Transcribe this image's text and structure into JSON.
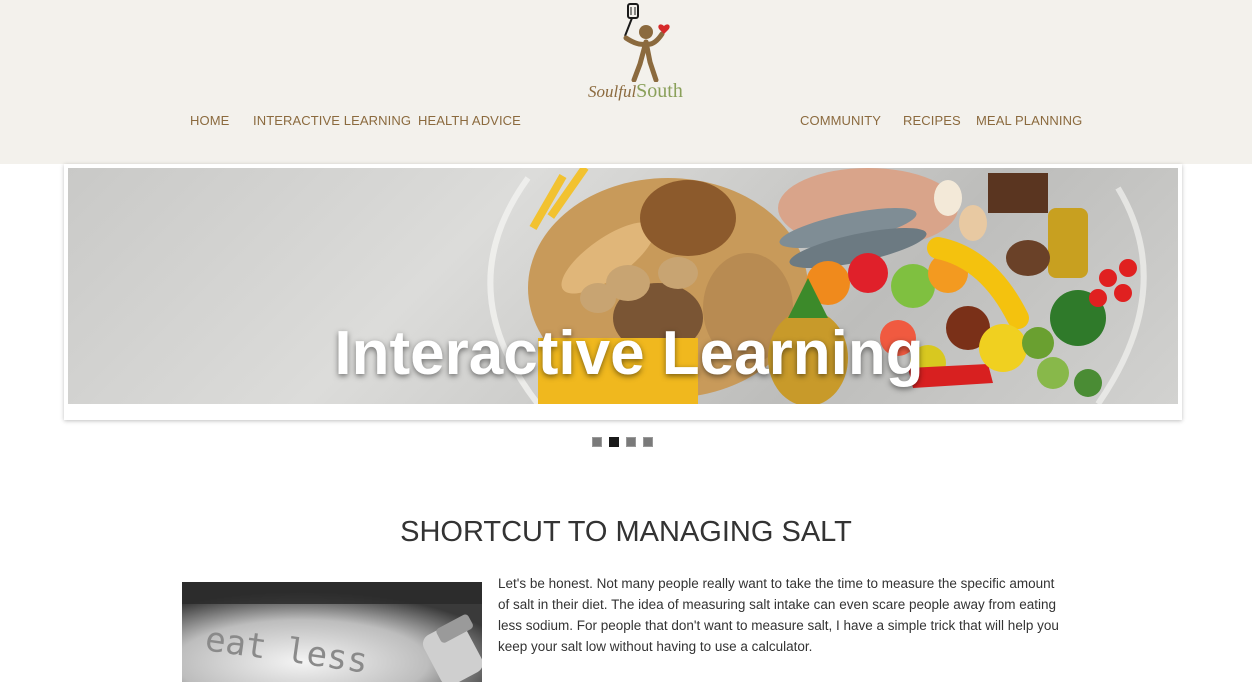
{
  "brand": {
    "logo_word1": "Soulful",
    "logo_word2": "South",
    "colors": {
      "brown": "#8b6a3e",
      "green": "#8aa05a",
      "heart": "#d62a2a"
    }
  },
  "nav": {
    "home": "HOME",
    "interactive_learning": "INTERACTIVE LEARNING",
    "health_advice": "HEALTH ADVICE",
    "community": "COMMUNITY",
    "recipes": "RECIPES",
    "meal_planning": "MEAL PLANNING"
  },
  "slider": {
    "caption": "Interactive Learning",
    "slide_count": 4,
    "active_index": 1
  },
  "article": {
    "title": "SHORTCUT TO MANAGING SALT",
    "image_text": "eat less",
    "body": "Let's be honest. Not many people really want to take the time to measure the specific amount of salt in their diet. The idea of measuring salt intake can even scare people away from eating less sodium. For people that don't want to measure salt, I have a simple trick that will help you keep your salt low without having to use a calculator."
  }
}
